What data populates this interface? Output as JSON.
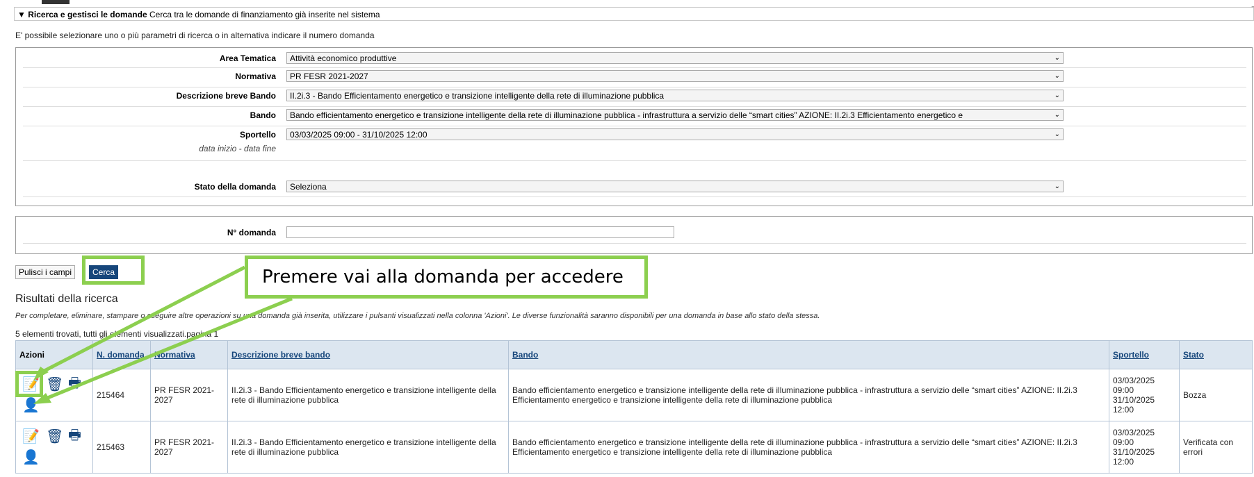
{
  "section": {
    "title_bold": "Ricerca e gestisci le domande",
    "title_rest": "Cerca tra le domande di finanziamento già inserite nel sistema",
    "info": "E' possibile selezionare uno o più parametri di ricerca o in alternativa indicare il numero domanda"
  },
  "filters": {
    "area_label": "Area Tematica",
    "area_value": "Attività economico produttive",
    "normativa_label": "Normativa",
    "normativa_value": "PR FESR 2021-2027",
    "desc_label": "Descrizione breve Bando",
    "desc_value": "II.2i.3 - Bando Efficientamento energetico e transizione intelligente della rete di illuminazione pubblica",
    "bando_label": "Bando",
    "bando_value": "Bando efficientamento energetico e transizione intelligente della rete di illuminazione pubblica - infrastruttura a servizio delle “smart cities” AZIONE: II.2i.3 Efficientamento energetico e",
    "sportello_label": "Sportello",
    "sportello_sub": "data inizio - data fine",
    "sportello_value": "03/03/2025 09:00 - 31/10/2025 12:00",
    "stato_label": "Stato della domanda",
    "stato_value": "Seleziona",
    "ndomanda_label": "N° domanda",
    "ndomanda_value": ""
  },
  "buttons": {
    "clear": "Pulisci i campi",
    "search": "Cerca"
  },
  "callout": "Premere vai alla domanda per accedere",
  "results": {
    "heading": "Risultati della ricerca",
    "description": "Per completare, eliminare, stampare o eseguire altre operazioni su una domanda già inserita, utilizzare i pulsanti visualizzati nella colonna 'Azioni'. Le diverse funzionalità saranno disponibili per una domanda in base allo stato della stessa.",
    "count": "5 elementi trovati, tutti gli elementi visualizzati.pagina 1",
    "columns": {
      "azioni": "Azioni",
      "n_domanda": "N. domanda",
      "normativa": "Normativa",
      "descrizione": "Descrizione breve bando",
      "bando": "Bando",
      "sportello": "Sportello",
      "stato": "Stato"
    },
    "rows": [
      {
        "n": "215464",
        "normativa": "PR FESR 2021-2027",
        "descrizione": "II.2i.3 - Bando Efficientamento energetico e transizione intelligente della rete di illuminazione pubblica",
        "bando": "Bando efficientamento energetico e transizione intelligente della rete di illuminazione pubblica - infrastruttura a servizio delle “smart cities” AZIONE: II.2i.3 Efficientamento energetico e transizione intelligente della rete di illuminazione pubblica",
        "sportello": "03/03/2025 09:00 31/10/2025 12:00",
        "stato": "Bozza"
      },
      {
        "n": "215463",
        "normativa": "PR FESR 2021-2027",
        "descrizione": "II.2i.3 - Bando Efficientamento energetico e transizione intelligente della rete di illuminazione pubblica",
        "bando": "Bando efficientamento energetico e transizione intelligente della rete di illuminazione pubblica - infrastruttura a servizio delle “smart cities” AZIONE: II.2i.3 Efficientamento energetico e transizione intelligente della rete di illuminazione pubblica",
        "sportello": "03/03/2025 09:00 31/10/2025 12:00",
        "stato": "Verificata con errori"
      }
    ]
  },
  "icons": {
    "edit": "edit-icon",
    "delete": "trash-icon",
    "print": "print-icon",
    "user": "user-icon"
  },
  "colors": {
    "accent": "#16467b",
    "highlight": "#8ccf4f",
    "table_header": "#dce6f0"
  }
}
